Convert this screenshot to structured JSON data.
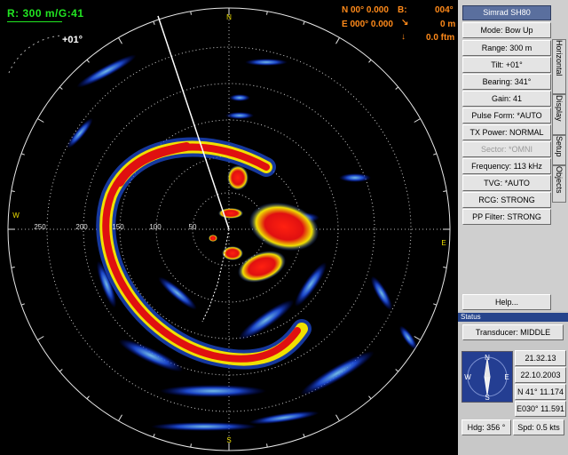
{
  "window": {
    "app_title": "Simrad SH80"
  },
  "sonar": {
    "range_readout": "R: 300 m/G:41",
    "tilt_readout": "+01°",
    "position": {
      "lat": "N  00° 0.000",
      "lon": "E 000° 0.000",
      "b_label": "B:",
      "b_value": "004°",
      "depth_m": "0 m",
      "depth_ftm": "0.0 ftm"
    },
    "compass_labels": {
      "n": "N",
      "e": "E",
      "s": "S",
      "w": "W"
    },
    "ring_labels": [
      "250",
      "200",
      "150",
      "100",
      "50"
    ]
  },
  "controls": {
    "mode": "Mode: Bow Up",
    "range": "Range: 300 m",
    "tilt": "Tilt: +01°",
    "bearing": "Bearing: 341°",
    "gain": "Gain: 41",
    "pulse_form": "Pulse Form: *AUTO",
    "tx_power": "TX Power: NORMAL",
    "sector": "Sector: *OMNI",
    "frequency": "Frequency: 113 kHz",
    "tvg": "TVG: *AUTO",
    "rcg": "RCG: STRONG",
    "pp_filter": "PP Filter: STRONG",
    "help": "Help..."
  },
  "tabs": [
    "Horizontal",
    "Display",
    "Setup",
    "Objects"
  ],
  "status": {
    "title": "Status",
    "transducer": "Transducer: MIDDLE",
    "time": "21.32.13",
    "date": "22.10.2003",
    "lat": "N  41° 11.174",
    "lon": "E030° 11.591",
    "heading": "Hdg: 356 °",
    "speed": "Spd: 0.5 kts",
    "compass_letters": {
      "n": "N",
      "e": "E",
      "s": "S",
      "w": "W"
    }
  },
  "colors": {
    "echo_strong": "#e01010",
    "echo_mid": "#f0e000",
    "echo_weak": "#2050e0",
    "readout_green": "#22e622",
    "readout_orange": "#ff8a1a",
    "panel_title": "#5a6f9e",
    "status_blue": "#243e92"
  },
  "icons": {
    "depth": "depth-arrow-icon",
    "fathom": "fathom-arrow-icon",
    "compass": "compass-rose-icon"
  }
}
